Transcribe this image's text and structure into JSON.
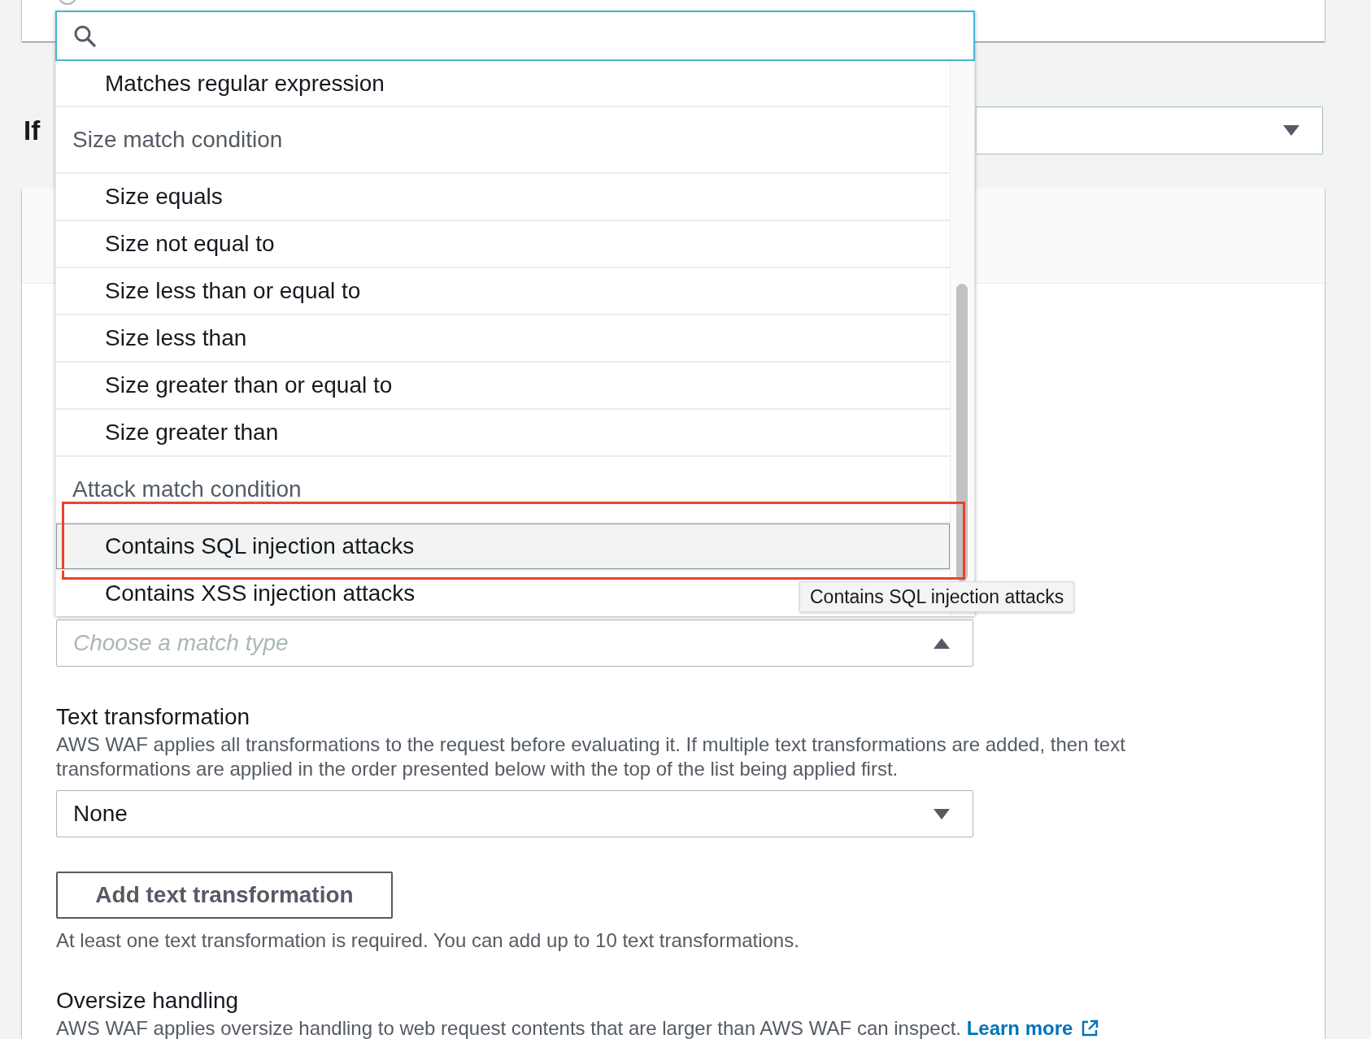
{
  "rule_type_panel": {
    "radio": {
      "checked": false
    }
  },
  "statement": {
    "heading": "If",
    "select": {
      "expanded": false
    }
  },
  "match_type": {
    "placeholder": "Choose a match type",
    "expanded": true,
    "groups": [
      {
        "options": [
          {
            "label": "Matches regular expression",
            "highlighted": false,
            "annotated": false
          }
        ]
      },
      {
        "label": "Size match condition",
        "options": [
          {
            "label": "Size equals",
            "highlighted": false,
            "annotated": false
          },
          {
            "label": "Size not equal to",
            "highlighted": false,
            "annotated": false
          },
          {
            "label": "Size less than or equal to",
            "highlighted": false,
            "annotated": false
          },
          {
            "label": "Size less than",
            "highlighted": false,
            "annotated": false
          },
          {
            "label": "Size greater than or equal to",
            "highlighted": false,
            "annotated": false
          },
          {
            "label": "Size greater than",
            "highlighted": false,
            "annotated": false
          }
        ]
      },
      {
        "label": "Attack match condition",
        "options": [
          {
            "label": "Contains SQL injection attacks",
            "highlighted": true,
            "annotated": true
          },
          {
            "label": "Contains XSS injection attacks",
            "highlighted": false,
            "annotated": false
          }
        ]
      }
    ],
    "tooltip": "Contains SQL injection attacks"
  },
  "text_transformation": {
    "label": "Text transformation",
    "description": "AWS WAF applies all transformations to the request before evaluating it. If multiple text transformations are added, then text transformations are applied in the order presented below with the top of the list being applied first.",
    "select": {
      "value": "None",
      "expanded": false
    },
    "add_button": "Add text transformation",
    "hint": "At least one text transformation is required. You can add up to 10 text transformations."
  },
  "oversize_handling": {
    "label": "Oversize handling",
    "description": "AWS WAF applies oversize handling to web request contents that are larger than AWS WAF can inspect.",
    "link": "Learn more"
  }
}
